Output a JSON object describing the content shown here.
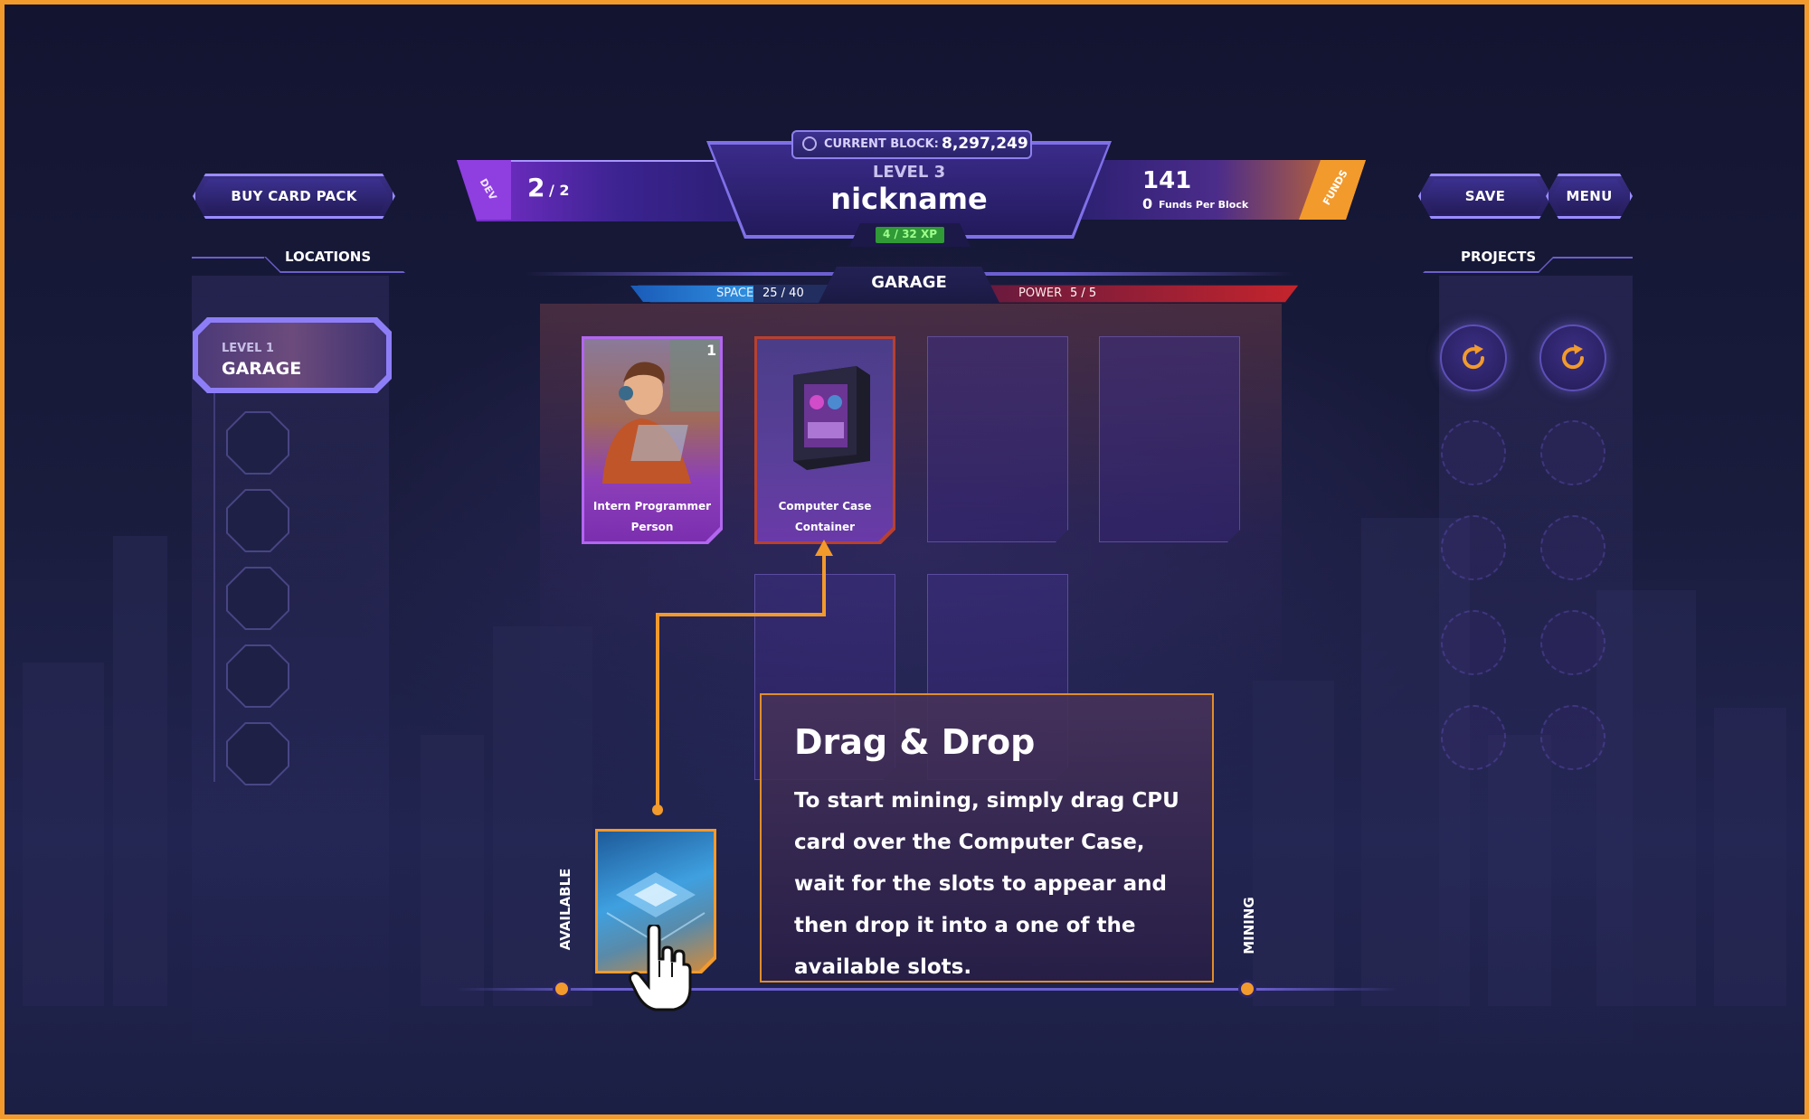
{
  "buttons": {
    "buy_card_pack": "BUY CARD PACK",
    "save": "SAVE",
    "menu": "MENU"
  },
  "header": {
    "current_block_label": "CURRENT BLOCK:",
    "current_block_value": "8,297,249",
    "dev_tag": "DEV",
    "dev_count": "2",
    "dev_total": "/ 2",
    "level": "LEVEL 3",
    "nickname": "nickname",
    "xp": "4 / 32 XP",
    "funds_value": "141",
    "funds_per_block_value": "0",
    "funds_per_block_label": "Funds Per Block",
    "funds_tag": "FUNDS"
  },
  "locations": {
    "title": "LOCATIONS",
    "active": {
      "level": "LEVEL 1",
      "name": "GARAGE"
    }
  },
  "projects": {
    "title": "PROJECTS"
  },
  "garage": {
    "title": "GARAGE",
    "space_label": "SPACE",
    "space_value": "25 / 40",
    "space_fraction": 0.625,
    "power_label": "POWER",
    "power_value": "5 / 5",
    "power_fraction": 1.0
  },
  "cards": [
    {
      "name": "Intern Programmer",
      "type": "Person",
      "count": "1"
    },
    {
      "name": "Computer Case",
      "type": "Container"
    }
  ],
  "tutorial": {
    "title": "Drag & Drop",
    "body": "To start mining, simply drag CPU card over the Computer Case, wait for the slots to appear  and then drop it into a one of the available slots."
  },
  "hand": {
    "available_label": "AVAILABLE",
    "mining_label": "MINING"
  },
  "colors": {
    "accent_orange": "#f29a2c",
    "accent_purple": "#9a8cff",
    "space_blue": "#2f8fe0",
    "power_red": "#c4242c",
    "xp_green": "#39c04a"
  }
}
